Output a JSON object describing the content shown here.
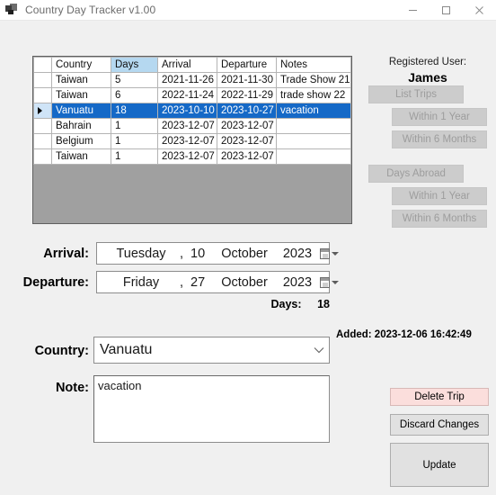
{
  "window": {
    "title": "Country Day Tracker v1.00",
    "icon": "app-form-icon",
    "minimize_label": "—",
    "maximize_label": "□",
    "close_label": "✕"
  },
  "grid": {
    "columns": [
      "",
      "Country",
      "Days",
      "Arrival",
      "Departure",
      "Notes"
    ],
    "selected_column": "Days",
    "selected_row_index": 2,
    "row_marker": "▶",
    "rows": [
      {
        "country": "Taiwan",
        "days": "5",
        "arrival": "2021-11-26",
        "departure": "2021-11-30",
        "notes": "Trade Show 21"
      },
      {
        "country": "Taiwan",
        "days": "6",
        "arrival": "2022-11-24",
        "departure": "2022-11-29",
        "notes": "trade show 22"
      },
      {
        "country": "Vanuatu",
        "days": "18",
        "arrival": "2023-10-10",
        "departure": "2023-10-27",
        "notes": "vacation"
      },
      {
        "country": "Bahrain",
        "days": "1",
        "arrival": "2023-12-07",
        "departure": "2023-12-07",
        "notes": ""
      },
      {
        "country": "Belgium",
        "days": "1",
        "arrival": "2023-12-07",
        "departure": "2023-12-07",
        "notes": ""
      },
      {
        "country": "Taiwan",
        "days": "1",
        "arrival": "2023-12-07",
        "departure": "2023-12-07",
        "notes": ""
      }
    ]
  },
  "right_panel": {
    "registered_user_label": "Registered User:",
    "registered_user_name": "James",
    "buttons": [
      {
        "label": "List Trips",
        "enabled": false
      },
      {
        "label": "Within 1 Year",
        "enabled": false
      },
      {
        "label": "Within 6 Months",
        "enabled": false
      },
      {
        "label": "Days Abroad",
        "enabled": false
      },
      {
        "label": "Within 1 Year",
        "enabled": false
      },
      {
        "label": "Within 6 Months",
        "enabled": false
      }
    ]
  },
  "form": {
    "arrival_label": "Arrival:",
    "arrival_date": {
      "weekday": "Tuesday",
      "separator": ",",
      "day": "10",
      "month": "October",
      "year": "2023"
    },
    "departure_label": "Departure:",
    "departure_date": {
      "weekday": "Friday",
      "separator": ",",
      "day": "27",
      "month": "October",
      "year": "2023"
    },
    "days_label": "Days:",
    "days_value": "18",
    "country_label": "Country:",
    "country_value": "Vanuatu",
    "added_text": "Added: 2023-12-06 16:42:49",
    "note_label": "Note:",
    "note_value": "vacation"
  },
  "actions": {
    "delete_label": "Delete Trip",
    "discard_label": "Discard Changes",
    "update_label": "Update"
  },
  "colors": {
    "selection_blue": "#1569c7",
    "header_select_blue": "#b5d8f0",
    "grid_background_gray": "#a0a0a0",
    "window_background": "#f0f0f0",
    "delete_button_pink": "#fbdedc"
  }
}
